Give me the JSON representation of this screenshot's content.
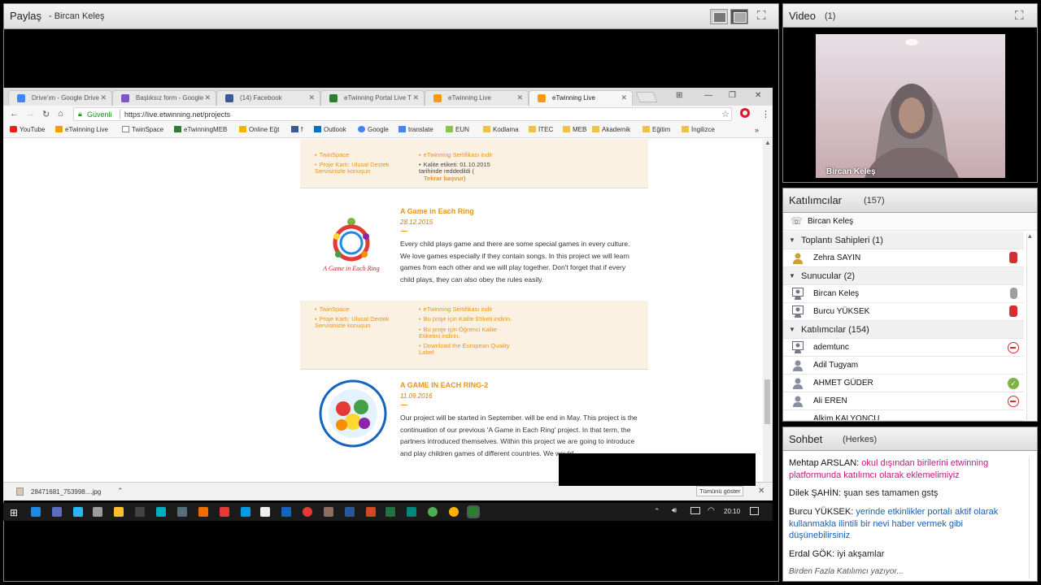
{
  "share": {
    "title": "Paylaş",
    "presenter": "- Bircan Keleş"
  },
  "browser": {
    "tabs": [
      {
        "label": "Drive'ım - Google Drive",
        "color": "#4285f4"
      },
      {
        "label": "Başlıksız form - Google",
        "color": "#7e57c2"
      },
      {
        "label": "(14) Facebook",
        "color": "#3b5998"
      },
      {
        "label": "eTwinning Portal Live T",
        "color": "#2e7d32"
      },
      {
        "label": "eTwinning Live",
        "color": "#f39c12"
      },
      {
        "label": "eTwinning Live",
        "color": "#f39c12"
      }
    ],
    "secure_label": "Güvenli",
    "url": "https://live.etwinning.net/projects",
    "bookmarks": [
      "YouTube",
      "eTwinning Live",
      "TwinSpace",
      "eTwinningMEB",
      "Online Eğt",
      "f",
      "Outlook",
      "Google",
      "translate",
      "EUN",
      "Kodlama",
      "İTEC",
      "MEB",
      "Akademik",
      "Eğitim",
      "İngilizce"
    ],
    "page": {
      "top_strip": {
        "left_links": [
          "TwinSpace",
          "Proje Kartı: Ulusal Destek Servisinizle konuşun"
        ],
        "right_links": [
          "eTwinning Sertifikası indir"
        ],
        "quality_text": "Kalite etiketi: 01.10.2015 tarihinde reddedildi (",
        "reapply": "Tekrar başvur)"
      },
      "projects": [
        {
          "title": "A Game in Each Ring",
          "date": "28.12.2015",
          "description": "Every child plays game and there are some special games in every culture. We love games especially if they contain songs. In this project we will learn games from each other and we will play together. Don't forget that if every child plays, they can also obey the rules easily.",
          "left_links": [
            "TwinSpace",
            "Proje Kartı: Ulusal Destek Servisinizle konuşun"
          ],
          "right_links": [
            "eTwinning Sertifikası indir",
            "Bu proje için Kalite Etiketi indirin.",
            "Bu proje için Öğrenci Kalite Etiketini indirin.",
            "Download the European Quality Label"
          ]
        },
        {
          "title": "A GAME IN EACH RING-2",
          "date": "11.09.2016",
          "description": "Our project will be started in September. will be end in May. This project is the continuation of our previous 'A Game in Each Ring' project. In that term, the partners introduced themselves. Within this project we are going to introduce and play children games of different countries. We would..."
        }
      ]
    },
    "download": {
      "file": "28471681_753998....jpg",
      "show_all": "Tümünü göster"
    },
    "clock": "20:10"
  },
  "video": {
    "title": "Video",
    "count": "(1)",
    "name": "Bircan Keleş"
  },
  "attendees": {
    "title": "Katılımcılar",
    "count": "(157)",
    "me": "Bircan Keleş",
    "groups": {
      "hosts": "Toplantı Sahipleri (1)",
      "presenters": "Sunucular (2)",
      "participants": "Katılımcılar (154)"
    },
    "hosts": [
      "Zehra  SAYIN"
    ],
    "presenters": [
      "Bircan Keleş",
      "Burcu YÜKSEK"
    ],
    "participants": [
      "ademtunc",
      "Adil Tugyam",
      "AHMET GÜDER",
      "Ali EREN",
      "Alkim KALYONCU"
    ]
  },
  "chat": {
    "title": "Sohbet",
    "scope": "(Herkes)",
    "messages": [
      {
        "author": "Mehtap ARSLAN:",
        "text": "okul dışından birilerini etwinning platformunda katılımcı olarak eklemelimiyiz"
      },
      {
        "author": "Dilek ŞAHİN:",
        "text": "şuan ses tamamen gstş"
      },
      {
        "author": "Burcu YÜKSEK:",
        "text": "yerinde etkinlikler portalı aktif olarak kullanmakla ilintili bir nevi haber vermek gibi düşünebilirsiniz"
      },
      {
        "author": "Erdal GÖK:",
        "text": "iyi akşamlar"
      }
    ],
    "typing": "Birden Fazla Katılımcı yazıyor..."
  },
  "colors": {
    "accent_orange": "#e5941e",
    "chat_pink": "#c5177f",
    "chat_blue": "#1a5fb4"
  }
}
